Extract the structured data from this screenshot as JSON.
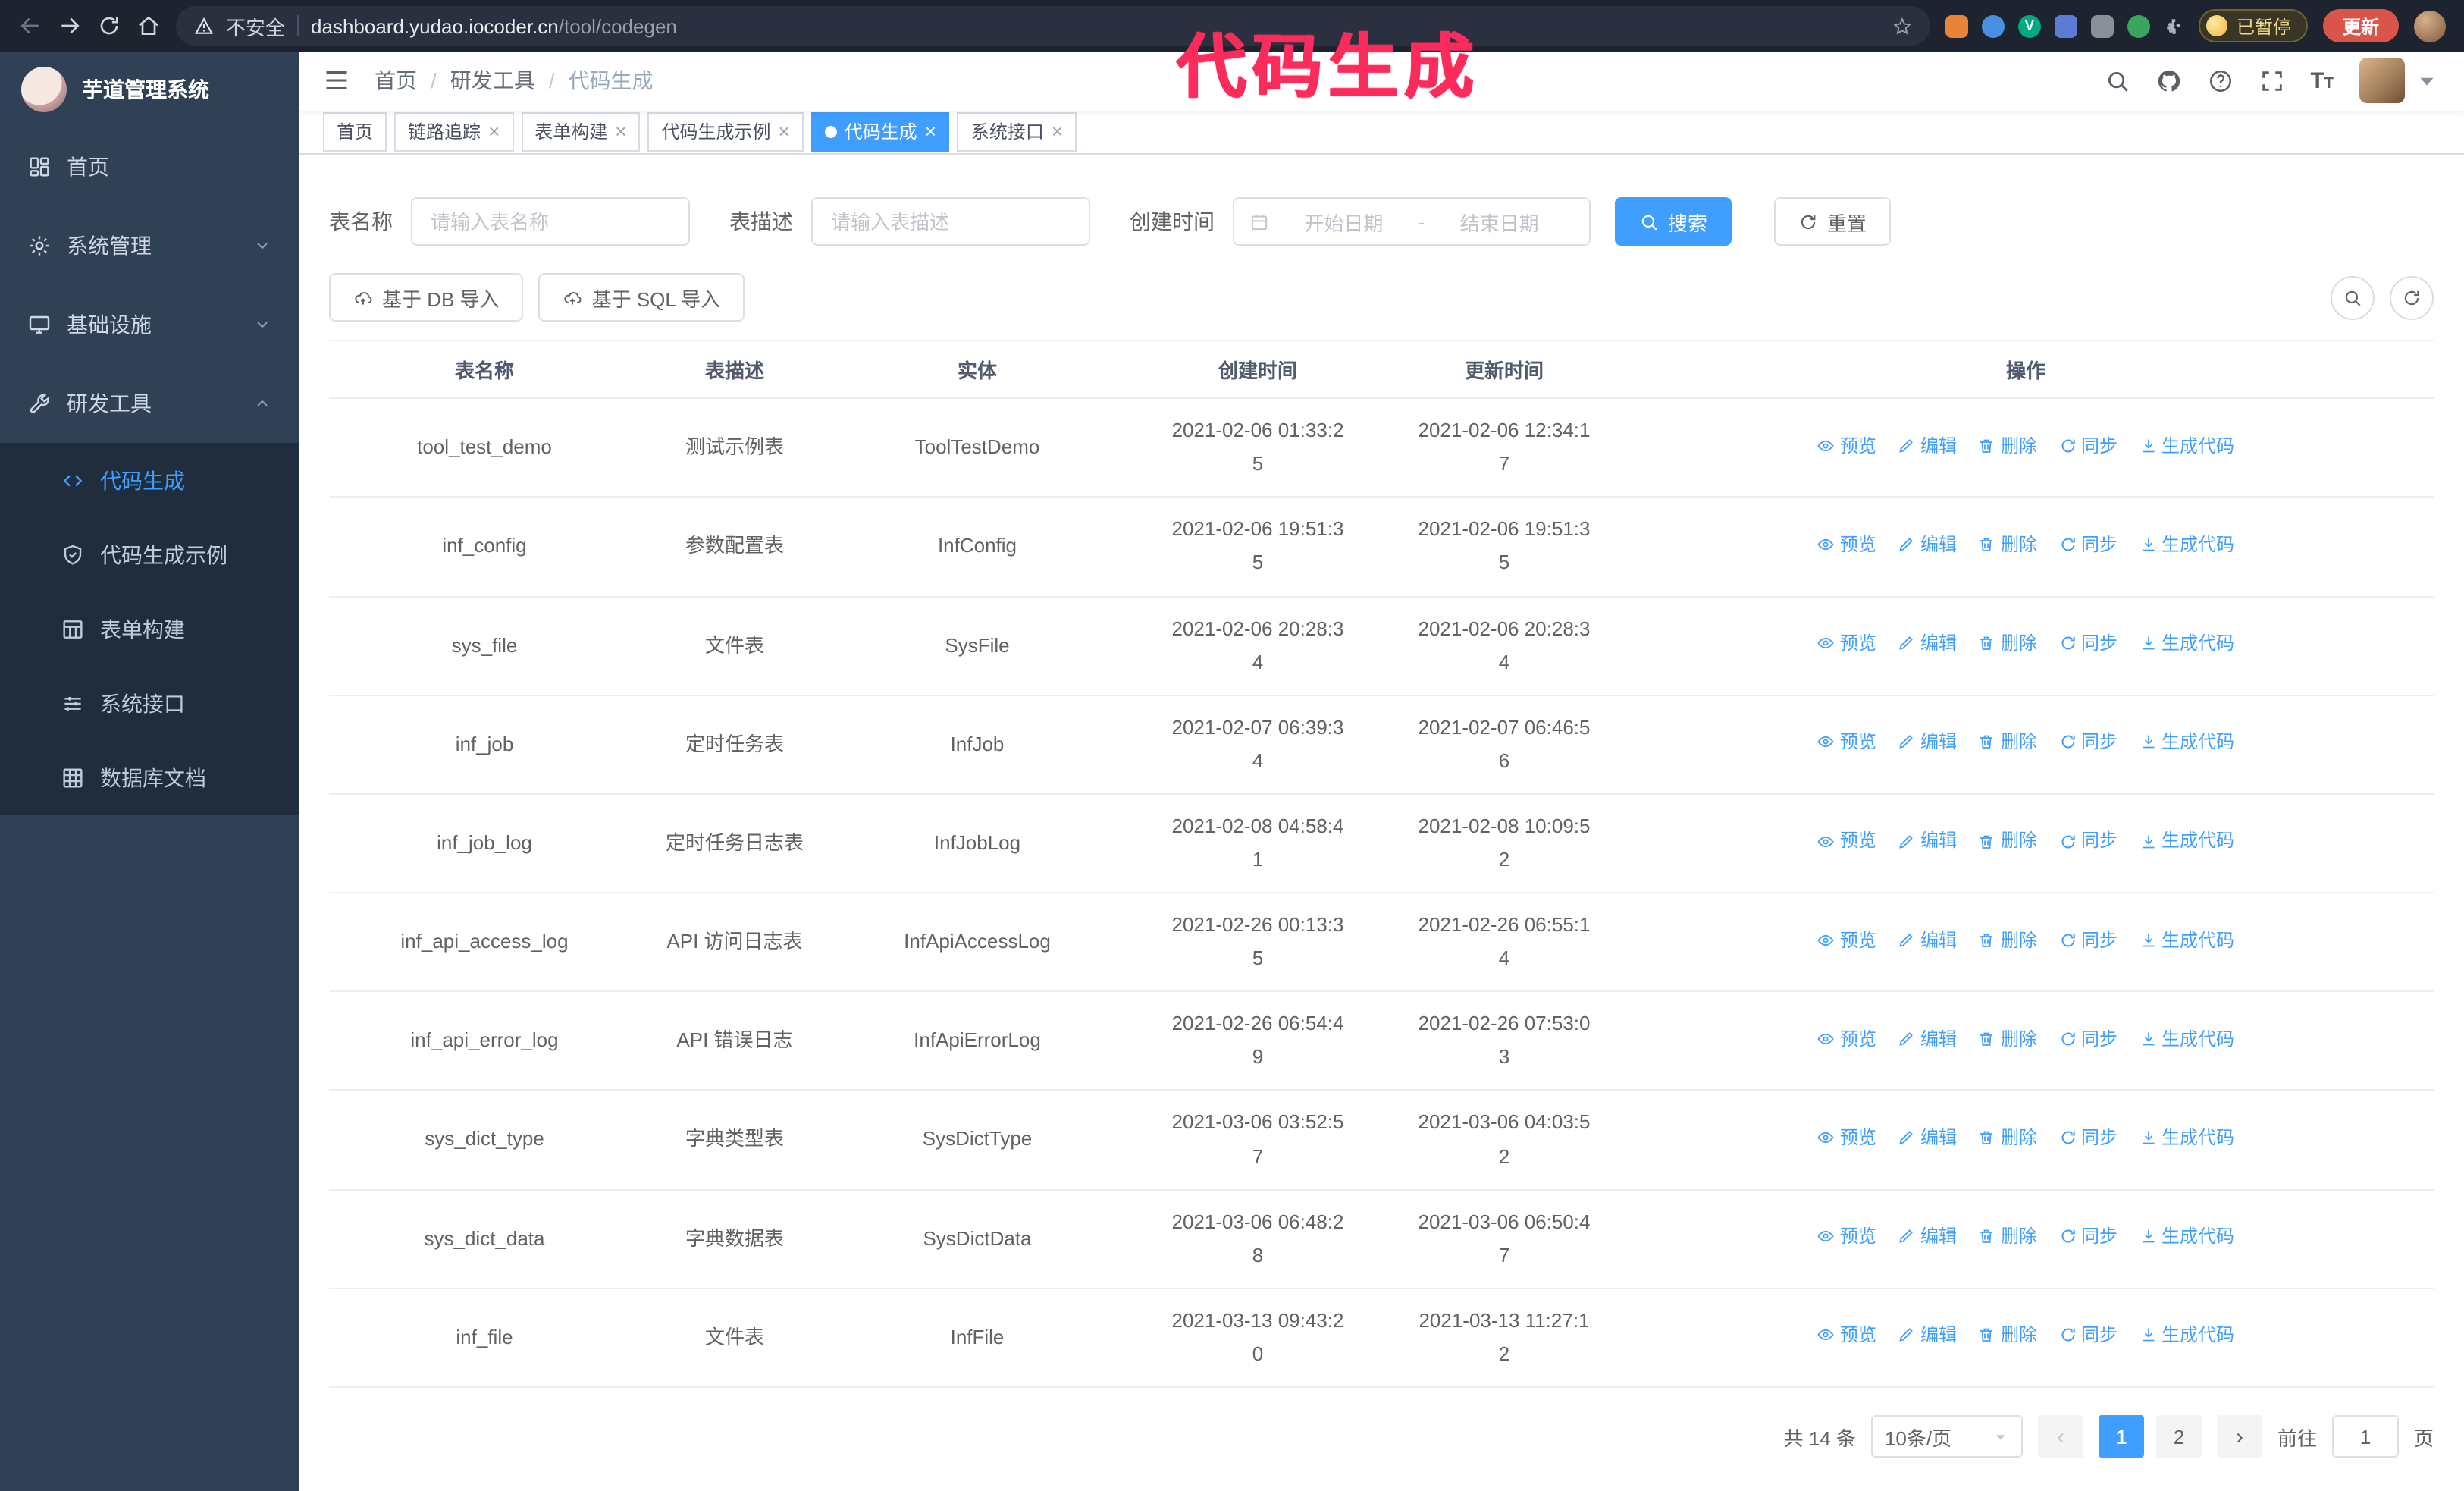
{
  "annotation": {
    "text": "代码生成",
    "color": "#fb2c5c"
  },
  "browser": {
    "security_label": "不安全",
    "url_host": "dashboard.yudao.iocoder.cn",
    "url_path": "/tool/codegen",
    "paused_badge": "已暂停",
    "update_button": "更新"
  },
  "sidebar": {
    "app_title": "芋道管理系统",
    "items": [
      {
        "key": "home",
        "label": "首页",
        "chevron": null,
        "expanded": false
      },
      {
        "key": "system",
        "label": "系统管理",
        "chevron": "down",
        "expanded": false
      },
      {
        "key": "infra",
        "label": "基础设施",
        "chevron": "down",
        "expanded": false
      },
      {
        "key": "tool",
        "label": "研发工具",
        "chevron": "up",
        "expanded": true
      }
    ],
    "subitems": [
      {
        "key": "codegen",
        "label": "代码生成",
        "active": true
      },
      {
        "key": "example",
        "label": "代码生成示例",
        "active": false
      },
      {
        "key": "form",
        "label": "表单构建",
        "active": false
      },
      {
        "key": "api",
        "label": "系统接口",
        "active": false
      },
      {
        "key": "db",
        "label": "数据库文档",
        "active": false
      }
    ]
  },
  "header": {
    "breadcrumb": [
      "首页",
      "研发工具",
      "代码生成"
    ]
  },
  "tabs": [
    {
      "key": "home",
      "label": "首页",
      "closable": false,
      "active": false
    },
    {
      "key": "tracer",
      "label": "链路追踪",
      "closable": true,
      "active": false
    },
    {
      "key": "form-builder",
      "label": "表单构建",
      "closable": true,
      "active": false
    },
    {
      "key": "codegen-example",
      "label": "代码生成示例",
      "closable": true,
      "active": false
    },
    {
      "key": "codegen",
      "label": "代码生成",
      "closable": true,
      "active": true
    },
    {
      "key": "system-api",
      "label": "系统接口",
      "closable": true,
      "active": false
    }
  ],
  "filters": {
    "table_name_label": "表名称",
    "table_name_placeholder": "请输入表名称",
    "table_desc_label": "表描述",
    "table_desc_placeholder": "请输入表描述",
    "create_time_label": "创建时间",
    "date_start_placeholder": "开始日期",
    "date_separator": "-",
    "date_end_placeholder": "结束日期",
    "search_button": "搜索",
    "reset_button": "重置"
  },
  "toolbar": {
    "import_db": "基于 DB 导入",
    "import_sql": "基于 SQL 导入"
  },
  "table": {
    "columns": [
      "表名称",
      "表描述",
      "实体",
      "创建时间",
      "更新时间",
      "操作"
    ],
    "actions": [
      "预览",
      "编辑",
      "删除",
      "同步",
      "生成代码"
    ],
    "rows": [
      {
        "name": "tool_test_demo",
        "desc": "测试示例表",
        "entity": "ToolTestDemo",
        "created": "2021-02-06 01:33:25",
        "updated": "2021-02-06 12:34:17"
      },
      {
        "name": "inf_config",
        "desc": "参数配置表",
        "entity": "InfConfig",
        "created": "2021-02-06 19:51:35",
        "updated": "2021-02-06 19:51:35"
      },
      {
        "name": "sys_file",
        "desc": "文件表",
        "entity": "SysFile",
        "created": "2021-02-06 20:28:34",
        "updated": "2021-02-06 20:28:34"
      },
      {
        "name": "inf_job",
        "desc": "定时任务表",
        "entity": "InfJob",
        "created": "2021-02-07 06:39:34",
        "updated": "2021-02-07 06:46:56"
      },
      {
        "name": "inf_job_log",
        "desc": "定时任务日志表",
        "entity": "InfJobLog",
        "created": "2021-02-08 04:58:41",
        "updated": "2021-02-08 10:09:52"
      },
      {
        "name": "inf_api_access_log",
        "desc": "API 访问日志表",
        "entity": "InfApiAccessLog",
        "created": "2021-02-26 00:13:35",
        "updated": "2021-02-26 06:55:14"
      },
      {
        "name": "inf_api_error_log",
        "desc": "API 错误日志",
        "entity": "InfApiErrorLog",
        "created": "2021-02-26 06:54:49",
        "updated": "2021-02-26 07:53:03"
      },
      {
        "name": "sys_dict_type",
        "desc": "字典类型表",
        "entity": "SysDictType",
        "created": "2021-03-06 03:52:57",
        "updated": "2021-03-06 04:03:52"
      },
      {
        "name": "sys_dict_data",
        "desc": "字典数据表",
        "entity": "SysDictData",
        "created": "2021-03-06 06:48:28",
        "updated": "2021-03-06 06:50:47"
      },
      {
        "name": "inf_file",
        "desc": "文件表",
        "entity": "InfFile",
        "created": "2021-03-13 09:43:20",
        "updated": "2021-03-13 11:27:12"
      }
    ]
  },
  "pagination": {
    "total": "共 14 条",
    "page_size": "10条/页",
    "pages": [
      "1",
      "2"
    ],
    "active_page": "1",
    "goto_label": "前往",
    "goto_value": "1",
    "goto_suffix": "页"
  },
  "theme": {
    "accent": "#409eff",
    "sidebar_bg": "#304156",
    "submenu_bg": "#1f2d3d"
  }
}
